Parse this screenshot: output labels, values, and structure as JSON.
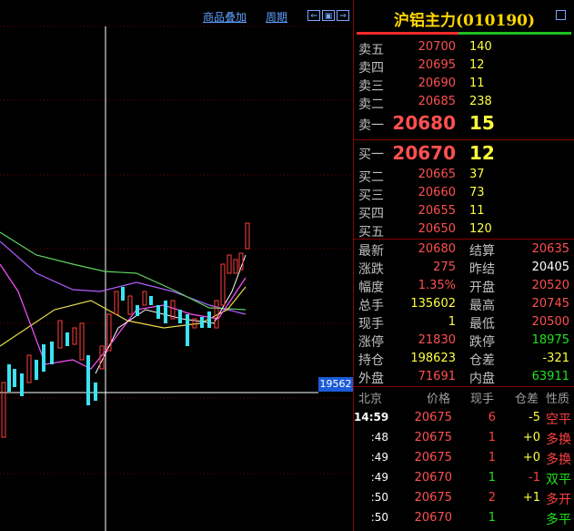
{
  "toolbar": {
    "overlay_label": "商品叠加",
    "period_label": "周期"
  },
  "chart": {
    "price_tag": "19562"
  },
  "panel": {
    "title": "沪铝主力(010190)",
    "asks": [
      {
        "label": "卖五",
        "price": "20700",
        "vol": "140"
      },
      {
        "label": "卖四",
        "price": "20695",
        "vol": "12"
      },
      {
        "label": "卖三",
        "price": "20690",
        "vol": "11"
      },
      {
        "label": "卖二",
        "price": "20685",
        "vol": "238"
      },
      {
        "label": "卖一",
        "price": "20680",
        "vol": "15"
      }
    ],
    "bids": [
      {
        "label": "买一",
        "price": "20670",
        "vol": "12"
      },
      {
        "label": "买二",
        "price": "20665",
        "vol": "37"
      },
      {
        "label": "买三",
        "price": "20660",
        "vol": "73"
      },
      {
        "label": "买四",
        "price": "20655",
        "vol": "11"
      },
      {
        "label": "买五",
        "price": "20650",
        "vol": "120"
      }
    ],
    "stats": [
      {
        "l1": "最新",
        "v1": "20680",
        "l2": "结算",
        "v2": "20635"
      },
      {
        "l1": "涨跌",
        "v1": "275",
        "l2": "昨结",
        "v2": "20405"
      },
      {
        "l1": "幅度",
        "v1": "1.35%",
        "l2": "开盘",
        "v2": "20520"
      },
      {
        "l1": "总手",
        "v1": "135602",
        "l2": "最高",
        "v2": "20745"
      },
      {
        "l1": "现手",
        "v1": "1",
        "l2": "最低",
        "v2": "20500"
      },
      {
        "l1": "涨停",
        "v1": "21830",
        "l2": "跌停",
        "v2": "18975"
      },
      {
        "l1": "持仓",
        "v1": "198623",
        "l2": "仓差",
        "v2": "-321"
      },
      {
        "l1": "外盘",
        "v1": "71691",
        "l2": "内盘",
        "v2": "63911"
      }
    ],
    "ticks_header": {
      "c1": "北京",
      "c2": "价格",
      "c3": "现手",
      "c4": "仓差",
      "c5": "性质"
    },
    "ticks": [
      {
        "time": "14:59",
        "price": "20675",
        "vol": "6",
        "diff": "-5",
        "nature": "空平"
      },
      {
        "time": ":48",
        "price": "20675",
        "vol": "1",
        "diff": "+0",
        "nature": "多换"
      },
      {
        "time": ":49",
        "price": "20675",
        "vol": "1",
        "diff": "+0",
        "nature": "多换"
      },
      {
        "time": ":49",
        "price": "20670",
        "vol": "1",
        "diff": "-1",
        "nature": "双平"
      },
      {
        "time": ":50",
        "price": "20675",
        "vol": "2",
        "diff": "+1",
        "nature": "多开"
      },
      {
        "time": ":50",
        "price": "20670",
        "vol": "1",
        "diff": "",
        "nature": "多平"
      }
    ]
  }
}
